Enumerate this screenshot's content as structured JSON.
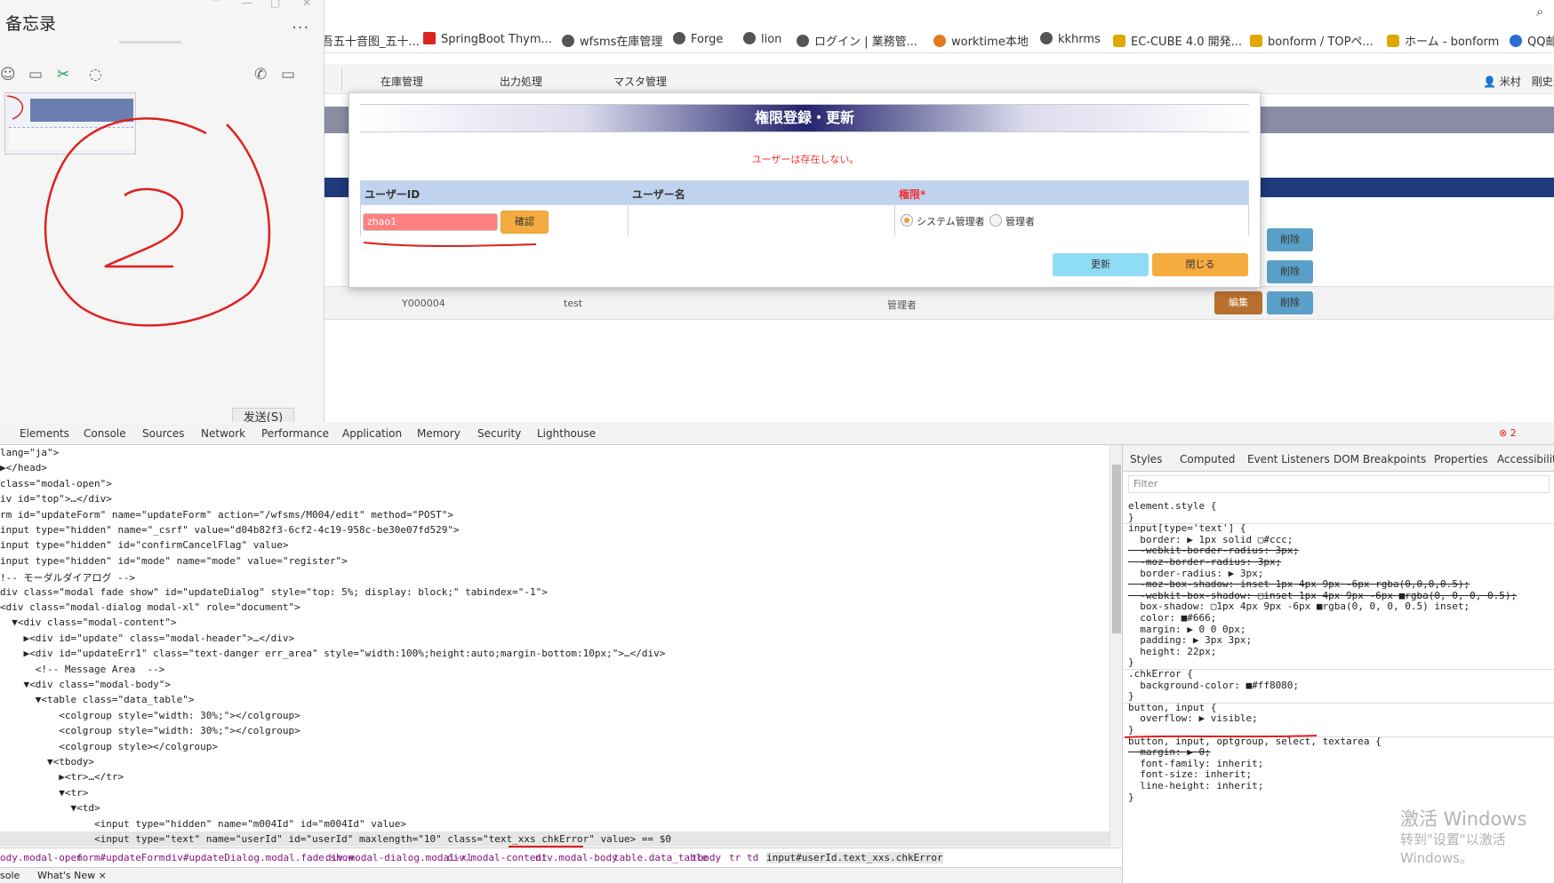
{
  "bookmarks": [
    {
      "label": "吾五十音图_五十...",
      "icon": "page-icon"
    },
    {
      "label": "SpringBoot Thym...",
      "icon": "red-square-icon"
    },
    {
      "label": "wfsms在庫管理",
      "icon": "globe-icon"
    },
    {
      "label": "Forge",
      "icon": "globe-icon"
    },
    {
      "label": "lion",
      "icon": "globe-icon"
    },
    {
      "label": "ログイン | 業務管...",
      "icon": "globe-icon"
    },
    {
      "label": "worktime本地",
      "icon": "sun-icon"
    },
    {
      "label": "kkhrms",
      "icon": "globe-icon"
    },
    {
      "label": "EC-CUBE 4.0 開発...",
      "icon": "cube-icon"
    },
    {
      "label": "bonform / TOPペ...",
      "icon": "cube-icon"
    },
    {
      "label": "ホーム - bonform",
      "icon": "cube-icon"
    },
    {
      "label": "QQ邮",
      "icon": "qq-icon"
    }
  ],
  "app": {
    "nav": [
      "在庫管理",
      "出力処理",
      "マスタ管理"
    ],
    "user": "米村　剛史",
    "row": {
      "user_id": "Y000004",
      "user_name": "test",
      "role": "管理者",
      "edit": "編集",
      "delete": "削除"
    }
  },
  "memo": {
    "title": "备忘录",
    "more": "...",
    "send_label": "发送(S)"
  },
  "modal": {
    "title": "権限登録・更新",
    "error": "ユーザーは存在しない。",
    "col_user_id": "ユーザーID",
    "col_user_name": "ユーザー名",
    "col_role": "権限*",
    "user_id_value": "zhao1",
    "confirm_label": "確認",
    "role_system_admin": "システム管理者",
    "role_admin": "管理者",
    "update_label": "更新",
    "close_label": "閉じる"
  },
  "devtools": {
    "tabs": [
      "Elements",
      "Console",
      "Sources",
      "Network",
      "Performance",
      "Application",
      "Memory",
      "Security",
      "Lighthouse"
    ],
    "errors": "2",
    "code_lines": [
      "lang=\"ja\">",
      "▶</head>",
      "class=\"modal-open\">",
      "iv id=\"top\">…</div>",
      "rm id=\"updateForm\" name=\"updateForm\" action=\"/wfsms/M004/edit\" method=\"POST\">",
      "input type=\"hidden\" name=\"_csrf\" value=\"d04b82f3-6cf2-4c19-958c-be30e07fd529\">",
      "input type=\"hidden\" id=\"confirmCancelFlag\" value>",
      "input type=\"hidden\" id=\"mode\" name=\"mode\" value=\"register\">",
      "!-- モーダルダイアログ -->",
      "div class=\"modal fade show\" id=\"updateDialog\" style=\"top: 5%; display: block;\" tabindex=\"-1\">",
      "<div class=\"modal-dialog modal-xl\" role=\"document\">",
      "  ▼<div class=\"modal-content\">",
      "    ▶<div id=\"update\" class=\"modal-header\">…</div>",
      "    ▶<div id=\"updateErr1\" class=\"text-danger err_area\" style=\"width:100%;height:auto;margin-bottom:10px;\">…</div>",
      "      <!-- Message Area  -->",
      "    ▼<div class=\"modal-body\">",
      "      ▼<table class=\"data_table\">",
      "          <colgroup style=\"width: 30%;\"></colgroup>",
      "          <colgroup style=\"width: 30%;\"></colgroup>",
      "          <colgroup style></colgroup>",
      "        ▼<tbody>",
      "          ▶<tr>…</tr>",
      "          ▼<tr>",
      "            ▼<td>",
      "                <input type=\"hidden\" name=\"m004Id\" id=\"m004Id\" value>",
      "                <input type=\"text\" name=\"userId\" id=\"userId\" maxlength=\"10\" class=\"text_xxs chkError\" value> == $0"
    ],
    "crumbs": [
      "ody.modal-open",
      "form#updateForm",
      "div#updateDialog.modal.fade.show",
      "div.modal-dialog.modal-xl",
      "div.modal-content",
      "div.modal-body",
      "table.data_table",
      "tbody",
      "tr",
      "td",
      "input#userId.text_xxs.chkError"
    ],
    "drawer": [
      "sole",
      "What's New ×"
    ],
    "styles_tabs": [
      "Styles",
      "Computed",
      "Event Listeners",
      "DOM Breakpoints",
      "Properties",
      "Accessibility"
    ],
    "filter_placeholder": "Filter",
    "style_lines": [
      "element.style {",
      "}",
      "input[type='text'] {",
      "  border: ▶ 1px solid ▢#ccc;",
      "  -webkit-border-radius: 3px;",
      "  -moz-border-radius: 3px;",
      "  border-radius: ▶ 3px;",
      "  -moz-box-shadow: inset 1px 4px 9px -6px rgba(0,0,0,0.5);",
      "  -webkit-box-shadow: ▢inset 1px 4px 9px -6px ■rgba(0, 0, 0, 0.5);",
      "  box-shadow: ▢1px 4px 9px -6px ■rgba(0, 0, 0, 0.5) inset;",
      "  color: ■#666;",
      "  margin: ▶ 0 0 0px;",
      "  padding: ▶ 3px 3px;",
      "  height: 22px;",
      "}",
      ".chkError {",
      "  background-color: ■#ff8080;",
      "}",
      "button, input {",
      "  overflow: ▶ visible;",
      "}",
      "button, input, optgroup, select, textarea {",
      "  margin: ▶ 0;",
      "  font-family: inherit;",
      "  font-size: inherit;",
      "  line-height: inherit;",
      "}"
    ],
    "watermark_1": "激活 Windows",
    "watermark_2": "转到\"设置\"以激活 Windows。"
  },
  "colors": {
    "error_bg": "#ff8080",
    "header_navy": "#23236e",
    "annotation_red": "#e02020"
  }
}
